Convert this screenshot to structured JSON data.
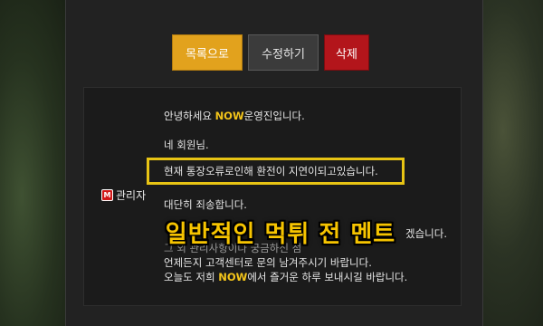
{
  "toolbar": {
    "list_label": "목록으로",
    "edit_label": "수정하기",
    "delete_label": "삭제"
  },
  "author": {
    "badge": "M",
    "name": "관리자"
  },
  "post": {
    "line1_a": "안녕하세요 ",
    "line1_hl": "NOW",
    "line1_b": "운영진입니다.",
    "line2": "네 회원님.",
    "line3": "현재 통장오류로인해 환전이 지연이되고있습니다.",
    "line4": "대단히 죄송합니다.",
    "line5_tail": "겠습니다.",
    "line6": "그 외 관리사항이나 궁금하신 점",
    "line7": "언제든지 고객센터로 문의 남겨주시기 바랍니다.",
    "line8_a": "오늘도 저희 ",
    "line8_hl": "NOW",
    "line8_b": "에서 즐거운 하루 보내시길 바랍니다."
  },
  "caption": "일반적인 먹튀 전 멘트",
  "colors": {
    "accent_gold": "#e2a21d",
    "delete_red": "#b3151b",
    "highlight_yellow": "#f3c41a"
  }
}
